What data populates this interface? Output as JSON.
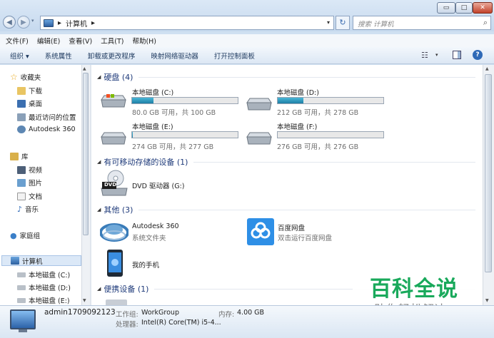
{
  "window": {
    "controls": {
      "minimize": "▭",
      "maximize": "□",
      "close": "✕"
    }
  },
  "address": {
    "breadcrumb_sep": "▸",
    "location": "计算机",
    "trail_sep": "▸",
    "dropdown": "▾",
    "refresh": "↻",
    "search_placeholder": "搜索 计算机",
    "search_icon": "⌕"
  },
  "menu": [
    "文件(F)",
    "编辑(E)",
    "查看(V)",
    "工具(T)",
    "帮助(H)"
  ],
  "toolbar": {
    "organize": "组织 ▾",
    "system_props": "系统属性",
    "uninstall": "卸载或更改程序",
    "map_drive": "映射网络驱动器",
    "control_panel": "打开控制面板",
    "help": "?"
  },
  "nav": {
    "favorites": "收藏夹",
    "downloads": "下载",
    "desktop": "桌面",
    "recent": "最近访问的位置",
    "autodesk": "Autodesk 360",
    "libraries": "库",
    "videos": "视频",
    "pictures": "图片",
    "documents": "文档",
    "music": "音乐",
    "homegroup": "家庭组",
    "computer": "计算机",
    "disk_c": "本地磁盘 (C:)",
    "disk_d": "本地磁盘 (D:)",
    "disk_e": "本地磁盘 (E:)"
  },
  "groups": {
    "hdd": "硬盘 (4)",
    "removable": "有可移动存储的设备 (1)",
    "other": "其他 (3)",
    "portable": "便携设备 (1)"
  },
  "drives": [
    {
      "name": "本地磁盘 (C:)",
      "free": "80.0 GB 可用，共 100 GB",
      "used_fraction": 0.2
    },
    {
      "name": "本地磁盘 (D:)",
      "free": "212 GB 可用，共 278 GB",
      "used_fraction": 0.24
    },
    {
      "name": "本地磁盘 (E:)",
      "free": "274 GB 可用，共 277 GB",
      "used_fraction": 0.01
    },
    {
      "name": "本地磁盘 (F:)",
      "free": "276 GB 可用，共 276 GB",
      "used_fraction": 0.0
    }
  ],
  "dvd": {
    "name": "DVD 驱动器 (G:)",
    "badge": "DVD"
  },
  "other": {
    "autodesk_name": "Autodesk 360",
    "autodesk_sub": "系统文件夹",
    "baidu_name": "百度网盘",
    "baidu_sub": "双击运行百度网盘",
    "phone": "我的手机"
  },
  "details": {
    "computer_name": "admin1709092123",
    "workgroup_label": "工作组:",
    "workgroup": "WorkGroup",
    "memory_label": "内存:",
    "memory": "4.00 GB",
    "cpu_label": "处理器:",
    "cpu": "Intel(R) Core(TM) i5-4..."
  },
  "watermark": {
    "title": "百科全说",
    "subtitle": "助你轻松解决"
  },
  "colors": {
    "accent": "#2f6ab7",
    "bar_fill": "#1e7ea6",
    "watermark": "#19a95b"
  }
}
